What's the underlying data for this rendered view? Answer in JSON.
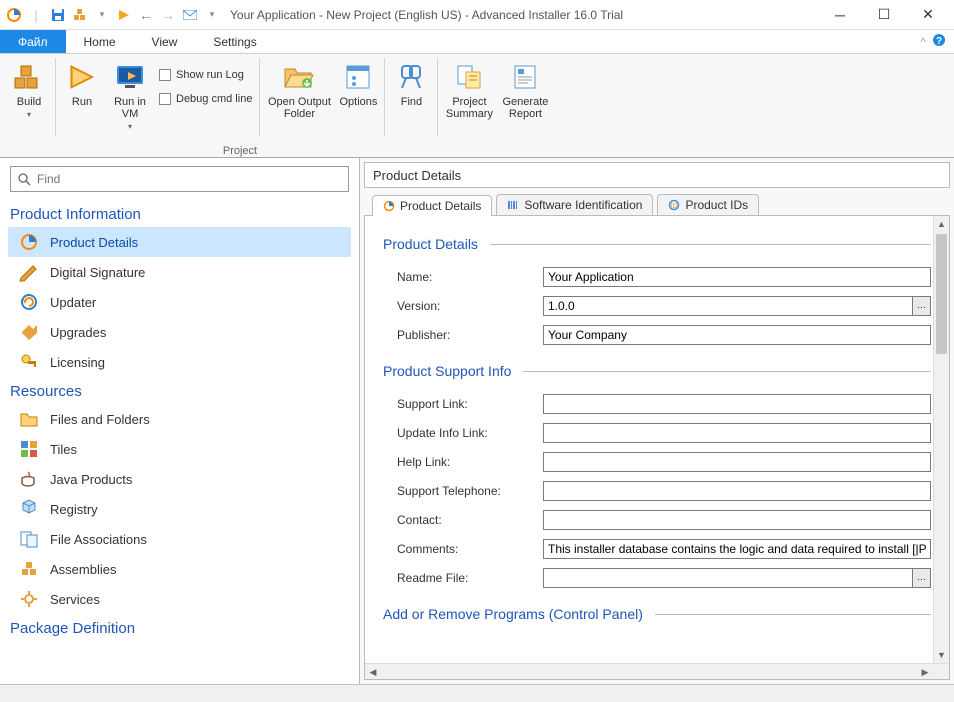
{
  "title": "Your Application - New Project (English US) - Advanced Installer 16.0 Trial",
  "menu": {
    "file": "Файл",
    "home": "Home",
    "view": "View",
    "settings": "Settings"
  },
  "ribbon": {
    "build": "Build",
    "run": "Run",
    "runvm": "Run in\nVM",
    "showlog": "Show run Log",
    "debugcmd": "Debug cmd line",
    "openoutput": "Open Output\nFolder",
    "options": "Options",
    "find": "Find",
    "summary": "Project\nSummary",
    "report": "Generate\nReport",
    "group": "Project"
  },
  "search_placeholder": "Find",
  "sidebar": {
    "s1": "Product Information",
    "s1items": [
      "Product Details",
      "Digital Signature",
      "Updater",
      "Upgrades",
      "Licensing"
    ],
    "s2": "Resources",
    "s2items": [
      "Files and Folders",
      "Tiles",
      "Java Products",
      "Registry",
      "File Associations",
      "Assemblies",
      "Services"
    ],
    "s3": "Package Definition"
  },
  "panel_title": "Product Details",
  "subtabs": [
    "Product Details",
    "Software Identification",
    "Product IDs"
  ],
  "form": {
    "sec1": "Product Details",
    "name_lbl": "Name:",
    "name_val": "Your Application",
    "version_lbl": "Version:",
    "version_val": "1.0.0",
    "publisher_lbl": "Publisher:",
    "publisher_val": "Your Company",
    "sec2": "Product Support Info",
    "support_lbl": "Support Link:",
    "support_val": "",
    "update_lbl": "Update Info Link:",
    "update_val": "",
    "help_lbl": "Help Link:",
    "help_val": "",
    "phone_lbl": "Support Telephone:",
    "phone_val": "",
    "contact_lbl": "Contact:",
    "contact_val": "",
    "comments_lbl": "Comments:",
    "comments_val": "This installer database contains the logic and data required to install [|Pro",
    "readme_lbl": "Readme File:",
    "readme_val": "",
    "sec3": "Add or Remove Programs (Control Panel)"
  }
}
